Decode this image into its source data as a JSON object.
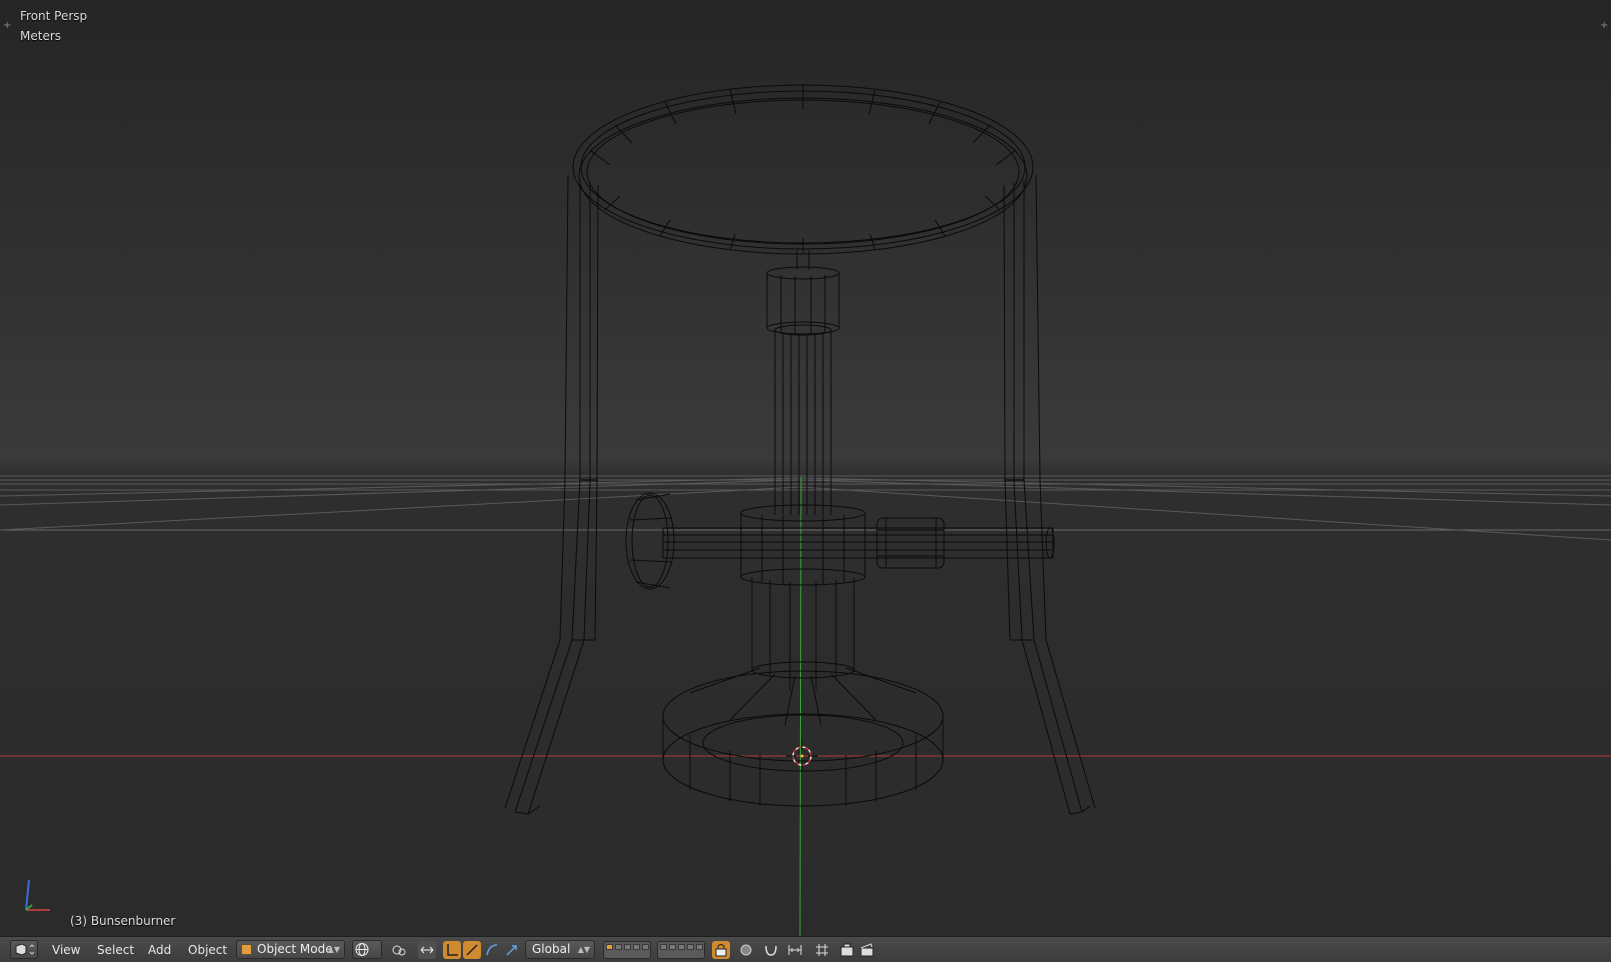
{
  "viewport": {
    "view_name": "Front Persp",
    "units": "Meters",
    "active_object": "(3) Bunsenburner",
    "colors": {
      "x_axis": "#b33a3a",
      "y_axis": "#3aa43a",
      "z_axis": "#3a6fd4",
      "wire": "#0b0b0b"
    }
  },
  "header": {
    "menus": [
      "View",
      "Select",
      "Add",
      "Object"
    ],
    "mode": "Object Mode",
    "orientation": "Global",
    "icons": [
      "editor-type-icon",
      "shading-icon",
      "pivot-icon",
      "manipulator-icon",
      "translate-icon",
      "rotate-icon",
      "scale-icon",
      "layers-icon",
      "lock-icon",
      "proportional-icon",
      "snap-icon",
      "render-icon",
      "clapper-icon"
    ]
  }
}
